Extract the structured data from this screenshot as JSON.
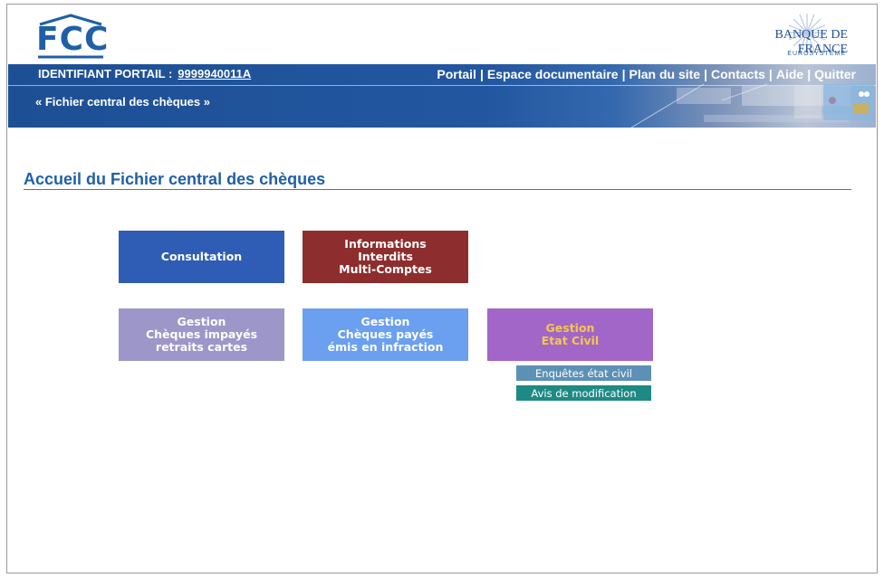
{
  "logos": {
    "fcc": "FCC",
    "bdf_name": "BANQUE DE FRANCE",
    "bdf_sub": "EUROSYSTÈME"
  },
  "banner": {
    "identifiant_label": "IDENTIFIANT PORTAIL :",
    "identifiant_value": "9999940011A",
    "app_name": "« Fichier central des chèques »",
    "links": [
      "Portail",
      "Espace documentaire",
      "Plan du site",
      "Contacts",
      "Aide",
      "Quitter"
    ]
  },
  "page": {
    "title": "Accueil du Fichier central des chèques"
  },
  "tiles": {
    "consultation": [
      "Consultation"
    ],
    "informations": [
      "Informations",
      "Interdits",
      "Multi-Comptes"
    ],
    "gestion_impayes": [
      "Gestion",
      "Chèques impayés",
      "retraits cartes"
    ],
    "gestion_payes": [
      "Gestion",
      "Chèques payés",
      "émis en infraction"
    ],
    "gestion_etat_civil": [
      "Gestion",
      "Etat Civil"
    ]
  },
  "sub_buttons": {
    "enquetes": "Enquêtes état civil",
    "avis": "Avis de modification"
  },
  "colors": {
    "banner": "#1d4f94",
    "consultation": "#2f5cb4",
    "informations": "#8e2d2d",
    "gestion_impayes": "#9d96c9",
    "gestion_payes": "#6b9ff0",
    "gestion_etat_civil": "#a266c8",
    "etat_civil_text": "#f5c74a",
    "enquetes": "#5c91b5",
    "avis": "#1d8a83"
  }
}
